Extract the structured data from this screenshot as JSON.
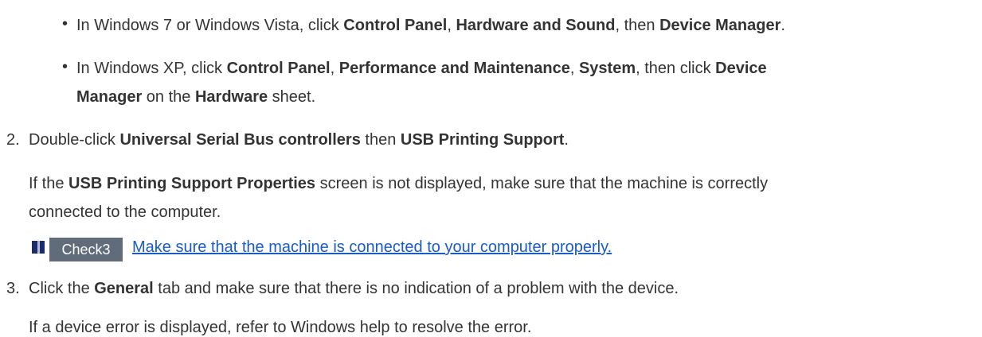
{
  "bullets": [
    {
      "prefix": "In Windows 7 or Windows Vista, click ",
      "b1": "Control Panel",
      "sep1": ", ",
      "b2": "Hardware and Sound",
      "sep2": ", then ",
      "b3": "Device Manager",
      "suffix": "."
    },
    {
      "prefix": "In Windows XP, click ",
      "b1": "Control Panel",
      "sep1": ", ",
      "b2": "Performance and Maintenance",
      "sep2": ", ",
      "b3": "System",
      "sep3": ", then click ",
      "b4a": "Device",
      "b4b": "Manager",
      "mid": " on the ",
      "b5": "Hardware",
      "suffix": " sheet."
    }
  ],
  "steps": [
    {
      "number": "2.",
      "prefix": "Double-click ",
      "b1": "Universal Serial Bus controllers",
      "mid": " then ",
      "b2": "USB Printing Support",
      "suffix": ".",
      "note_prefix": "If the ",
      "note_bold": "USB Printing Support Properties",
      "note_suffix_line1": " screen is not displayed, make sure that the machine is correctly",
      "note_line2": "connected to the computer."
    },
    {
      "number": "3.",
      "prefix": "Click the ",
      "b1": "General",
      "suffix": " tab and make sure that there is no indication of a problem with the device.",
      "note": "If a device error is displayed, refer to Windows help to resolve the error."
    }
  ],
  "check": {
    "label": "Check3",
    "link_text": "Make sure that the machine is connected to your computer properly.",
    "marker_color_dark": "#1a2c6b",
    "marker_color_light": "#b4bcd2",
    "badge_color": "#616c7a",
    "link_color": "#1a5bc4"
  }
}
